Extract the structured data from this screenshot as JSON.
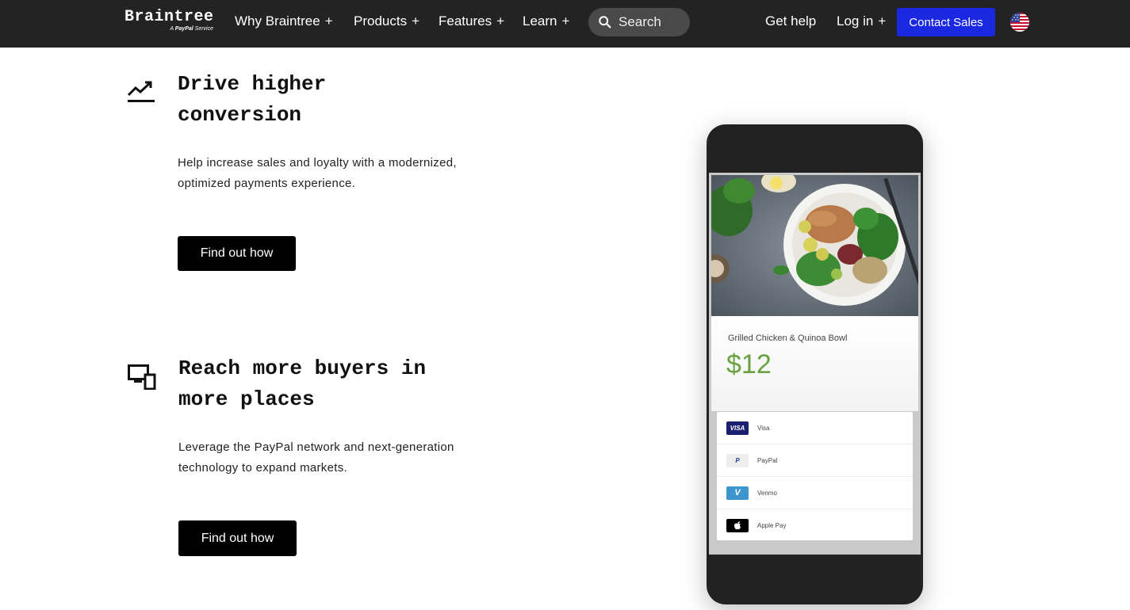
{
  "nav": {
    "logo_word": "Braintree",
    "logo_sub_prefix": "A",
    "logo_sub_brand": "PayPal",
    "logo_sub_suffix": "Service",
    "items": [
      {
        "label": "Why Braintree",
        "suffix": "+"
      },
      {
        "label": "Products",
        "suffix": "+"
      },
      {
        "label": "Features",
        "suffix": "+"
      },
      {
        "label": "Learn",
        "suffix": "+"
      }
    ],
    "search_placeholder": "Search",
    "get_help": "Get help",
    "login": "Log in",
    "login_suffix": "+",
    "contact_sales": "Contact Sales"
  },
  "features": [
    {
      "icon": "trending-up-icon",
      "title_line1": "Drive higher",
      "title_line2": "conversion",
      "desc_line1": "Help increase sales and loyalty with a modernized,",
      "desc_line2": "optimized payments experience.",
      "cta": "Find out how"
    },
    {
      "icon": "devices-icon",
      "title_line1": "Reach more buyers in",
      "title_line2": "more places",
      "desc_line1": "Leverage the PayPal network and next-generation",
      "desc_line2": "technology to expand markets.",
      "cta": "Find out how"
    }
  ],
  "phone": {
    "item_name": "Grilled Chicken & Quinoa Bowl",
    "price": "$12",
    "price_color": "#6aa242",
    "payment_methods": [
      {
        "label": "Visa",
        "badge": "VISA",
        "color": "#1a1f71"
      },
      {
        "label": "PayPal",
        "badge": "P",
        "color": "#eeeeee"
      },
      {
        "label": "Venmo",
        "badge": "V",
        "color": "#3d95ce"
      },
      {
        "label": "Apple Pay",
        "badge": "",
        "color": "#000000"
      }
    ]
  },
  "colors": {
    "nav_bg": "#232323",
    "contact_bg": "#1a28e2",
    "cta_bg": "#000000"
  }
}
